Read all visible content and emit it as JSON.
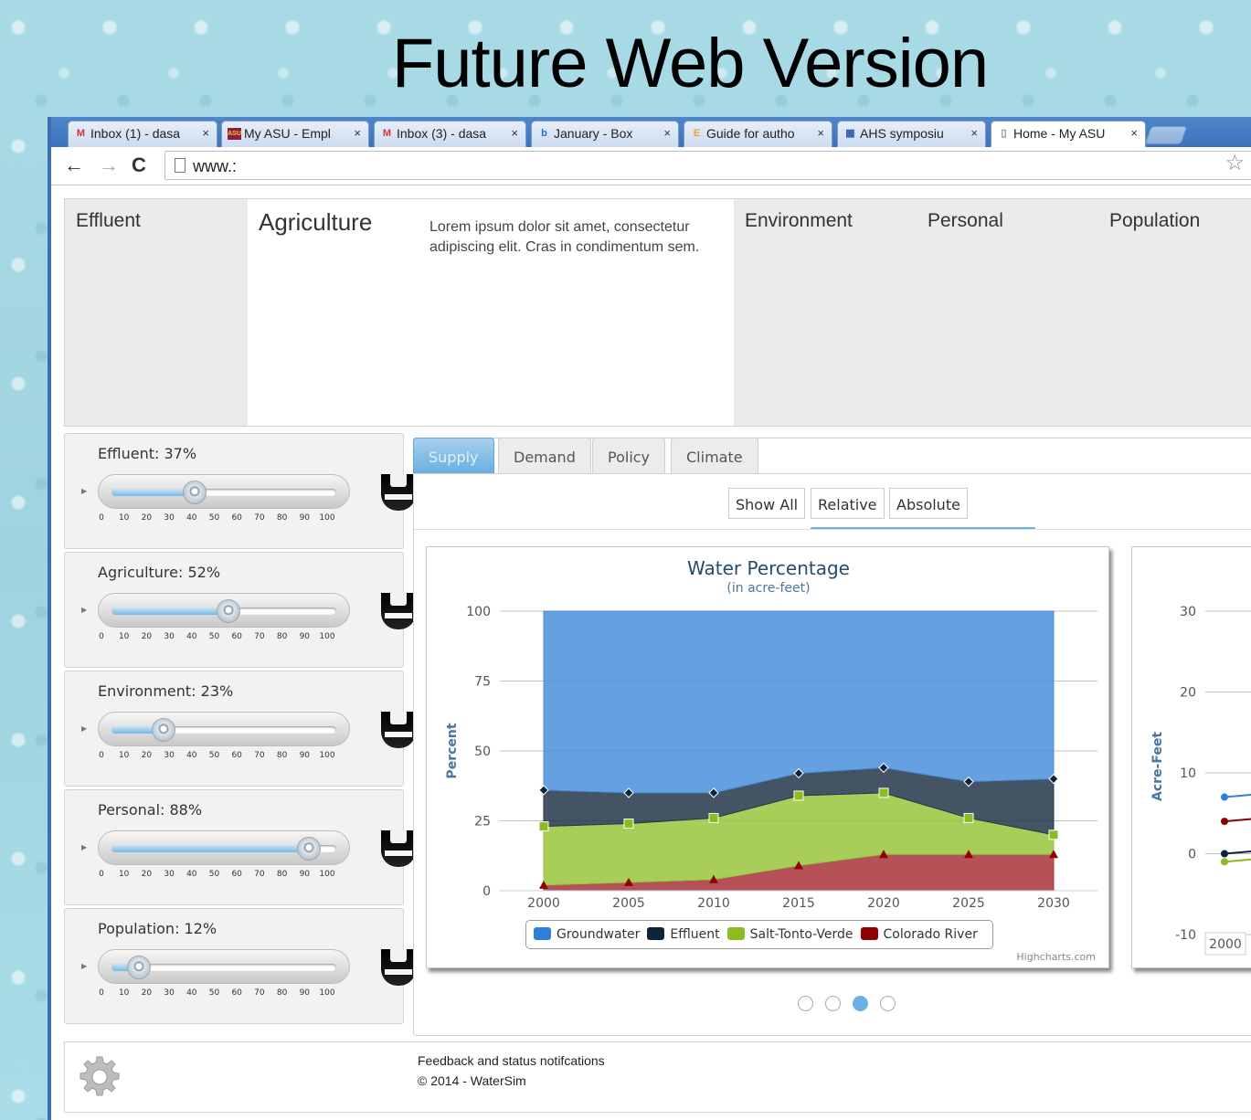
{
  "slide": {
    "title": "Future Web Version"
  },
  "browser": {
    "tabs": [
      {
        "label": "Inbox (1) - dasa",
        "icon": "gmail-icon",
        "glyph": "M",
        "color": "#d33"
      },
      {
        "label": "My ASU - Empl",
        "icon": "asu-icon",
        "glyph": "ASU",
        "color": "#8c1d40"
      },
      {
        "label": "Inbox (3) - dasa",
        "icon": "gmail-icon",
        "glyph": "M",
        "color": "#d33"
      },
      {
        "label": "January - Box",
        "icon": "box-icon",
        "glyph": "b",
        "color": "#1a74c0"
      },
      {
        "label": "Guide for autho",
        "icon": "elsevier-icon",
        "glyph": "E",
        "color": "#f0a030"
      },
      {
        "label": "AHS symposiu",
        "icon": "grid-icon",
        "glyph": "▦",
        "color": "#2a5ea8"
      },
      {
        "label": "Home - My ASU",
        "icon": "page-icon",
        "glyph": "▯",
        "color": "#888"
      }
    ],
    "url": "www.:"
  },
  "topnav": {
    "items": [
      "Effluent",
      "Agriculture",
      "Environment",
      "Personal",
      "Population"
    ],
    "active_description": "Lorem ipsum dolor sit amet, consectetur adipiscing elit. Cras in condimentum sem."
  },
  "sliders": [
    {
      "label": "Effluent: 37%",
      "value": 37
    },
    {
      "label": "Agriculture: 52%",
      "value": 52
    },
    {
      "label": "Environment: 23%",
      "value": 23
    },
    {
      "label": "Personal: 88%",
      "value": 88
    },
    {
      "label": "Population: 12%",
      "value": 12
    }
  ],
  "slider_ticks": [
    "0",
    "10",
    "20",
    "30",
    "40",
    "50",
    "60",
    "70",
    "80",
    "90",
    "100"
  ],
  "chart_tabs": [
    "Supply",
    "Demand",
    "Policy",
    "Climate"
  ],
  "view_buttons": [
    "Show All",
    "Relative",
    "Absolute"
  ],
  "chart_data": [
    {
      "type": "area",
      "title": "Water Percentage",
      "subtitle": "(in acre-feet)",
      "ylabel": "Percent",
      "x": [
        2000,
        2005,
        2010,
        2015,
        2020,
        2025,
        2030
      ],
      "ylim": [
        0,
        100
      ],
      "yticks": [
        0,
        25,
        50,
        75,
        100
      ],
      "stacked": true,
      "series": [
        {
          "name": "Colorado River",
          "values": [
            2,
            3,
            4,
            9,
            13,
            13,
            13
          ],
          "color": "#a8343a",
          "marker": "triangle"
        },
        {
          "name": "Salt-Tonto-Verde",
          "values": [
            21,
            21,
            22,
            25,
            22,
            13,
            7
          ],
          "color": "#9ac43c",
          "marker": "square"
        },
        {
          "name": "Effluent",
          "values": [
            13,
            11,
            9,
            8,
            9,
            13,
            20
          ],
          "color": "#24364a",
          "marker": "diamond"
        },
        {
          "name": "Groundwater",
          "values": [
            64,
            65,
            65,
            58,
            56,
            61,
            60
          ],
          "color": "#4a8fdc",
          "marker": "circle"
        }
      ],
      "legend": [
        "Groundwater",
        "Effluent",
        "Salt-Tonto-Verde",
        "Colorado River"
      ],
      "credit": "Highcharts.com"
    },
    {
      "type": "line",
      "ylabel": "Acre-Feet",
      "ylim": [
        -10,
        30
      ],
      "yticks": [
        -10,
        0,
        10,
        20,
        30
      ],
      "x_visible": [
        "2000"
      ],
      "series": [
        {
          "name": "Groundwater",
          "values": [
            7
          ],
          "color": "#2f7ed8"
        },
        {
          "name": "Colorado River",
          "values": [
            4
          ],
          "color": "#8b0000"
        },
        {
          "name": "Effluent",
          "values": [
            0
          ],
          "color": "#0d233a"
        },
        {
          "name": "Salt-Tonto-Verde",
          "values": [
            -1
          ],
          "color": "#8bbc21"
        }
      ]
    }
  ],
  "footer": {
    "status": "Feedback and status notifcations",
    "copyright": "© 2014 - WaterSim"
  }
}
